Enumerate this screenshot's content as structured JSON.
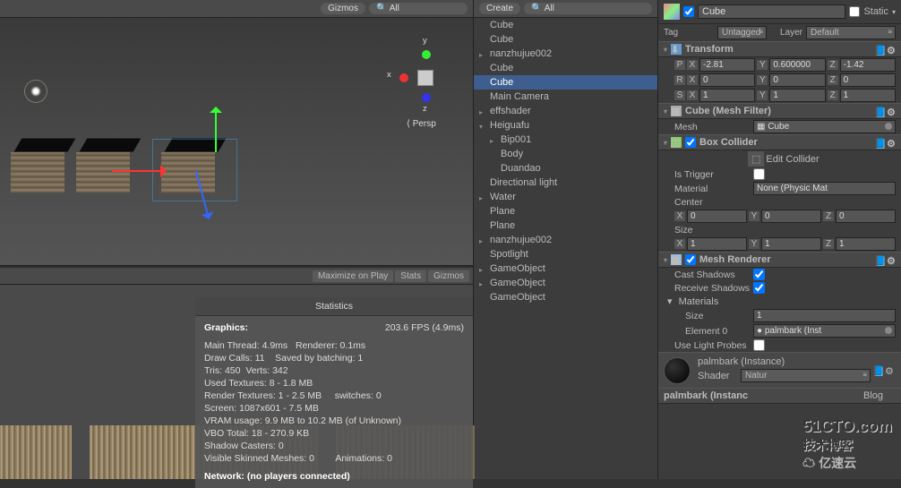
{
  "scene_toolbar": {
    "gizmos": "Gizmos",
    "search": "All"
  },
  "scene_gizmo": {
    "x": "x",
    "y": "y",
    "z": "z",
    "persp": "Persp"
  },
  "game_toolbar": {
    "maximize": "Maximize on Play",
    "stats": "Stats",
    "gizmos": "Gizmos"
  },
  "stats": {
    "title": "Statistics",
    "graphics": "Graphics:",
    "fps": "203.6 FPS (4.9ms)",
    "main_thread": "Main Thread: 4.9ms",
    "renderer": "Renderer: 0.1ms",
    "draw_calls": "Draw Calls: 11",
    "batching": "Saved by batching: 1",
    "tris": "Tris: 450",
    "verts": "Verts: 342",
    "used_tex": "Used Textures: 8 - 1.8 MB",
    "render_tex": "Render Textures: 1 - 2.5 MB",
    "switches": "switches: 0",
    "screen": "Screen: 1087x601 - 7.5 MB",
    "vram": "VRAM usage: 9.9 MB to 10.2 MB (of Unknown)",
    "vbo": "VBO Total: 18 - 270.9 KB",
    "shadow": "Shadow Casters: 0",
    "skinned": "Visible Skinned Meshes: 0",
    "anim": "Animations: 0",
    "network": "Network: (no players connected)"
  },
  "hierarchy": {
    "create": "Create",
    "search": "All",
    "items": [
      {
        "name": "Cube",
        "ind": 0
      },
      {
        "name": "Cube",
        "ind": 0
      },
      {
        "name": "nanzhujue002",
        "ind": 0,
        "arrow": "▸"
      },
      {
        "name": "Cube",
        "ind": 0
      },
      {
        "name": "Cube",
        "ind": 0,
        "sel": true
      },
      {
        "name": "Main Camera",
        "ind": 0
      },
      {
        "name": "effshader",
        "ind": 0,
        "arrow": "▸"
      },
      {
        "name": "Heiguafu",
        "ind": 0,
        "arrow": "▾"
      },
      {
        "name": "Bip001",
        "ind": 1,
        "arrow": "▸"
      },
      {
        "name": "Body",
        "ind": 1
      },
      {
        "name": "Duandao",
        "ind": 1
      },
      {
        "name": "Directional light",
        "ind": 0
      },
      {
        "name": "Water",
        "ind": 0,
        "arrow": "▸"
      },
      {
        "name": "Plane",
        "ind": 0
      },
      {
        "name": "Plane",
        "ind": 0
      },
      {
        "name": "nanzhujue002",
        "ind": 0,
        "arrow": "▸"
      },
      {
        "name": "Spotlight",
        "ind": 0
      },
      {
        "name": "GameObject",
        "ind": 0,
        "arrow": "▸"
      },
      {
        "name": "GameObject",
        "ind": 0,
        "arrow": "▸"
      },
      {
        "name": "GameObject",
        "ind": 0
      }
    ]
  },
  "inspector": {
    "name": "Cube",
    "static": "Static",
    "tag_label": "Tag",
    "tag_value": "Untagged",
    "layer_label": "Layer",
    "layer_value": "Default",
    "transform": {
      "title": "Transform",
      "position": "P",
      "rotation": "R",
      "scale": "S",
      "px": "-2.81",
      "py": "0.600000",
      "pz": "-1.42",
      "rx": "0",
      "ry": "0",
      "rz": "0",
      "sx": "1",
      "sy": "1",
      "sz": "1",
      "xl": "X",
      "yl": "Y",
      "zl": "Z"
    },
    "mesh_filter": {
      "title": "Cube (Mesh Filter)",
      "mesh_label": "Mesh",
      "mesh_value": "Cube"
    },
    "box_collider": {
      "title": "Box Collider",
      "edit": "Edit Collider",
      "is_trigger": "Is Trigger",
      "material": "Material",
      "material_value": "None (Physic Mat",
      "center": "Center",
      "size": "Size",
      "cx": "0",
      "cy": "0",
      "cz": "0",
      "sx": "1",
      "sy": "1",
      "sz": "1"
    },
    "mesh_renderer": {
      "title": "Mesh Renderer",
      "cast": "Cast Shadows",
      "receive": "Receive Shadows",
      "materials": "Materials",
      "size": "Size",
      "size_val": "1",
      "element": "Element 0",
      "element_val": "palmbark (Inst",
      "probes": "Use Light Probes"
    },
    "material": {
      "name": "palmbark (Instance)",
      "shader": "Shader",
      "shader_val": "Natur",
      "footer": "palmbark (Instanc",
      "blog": "Blog"
    }
  },
  "watermark": {
    "line1": "51CTO.com",
    "line2": "技术博客",
    "line3": "亿速云"
  }
}
